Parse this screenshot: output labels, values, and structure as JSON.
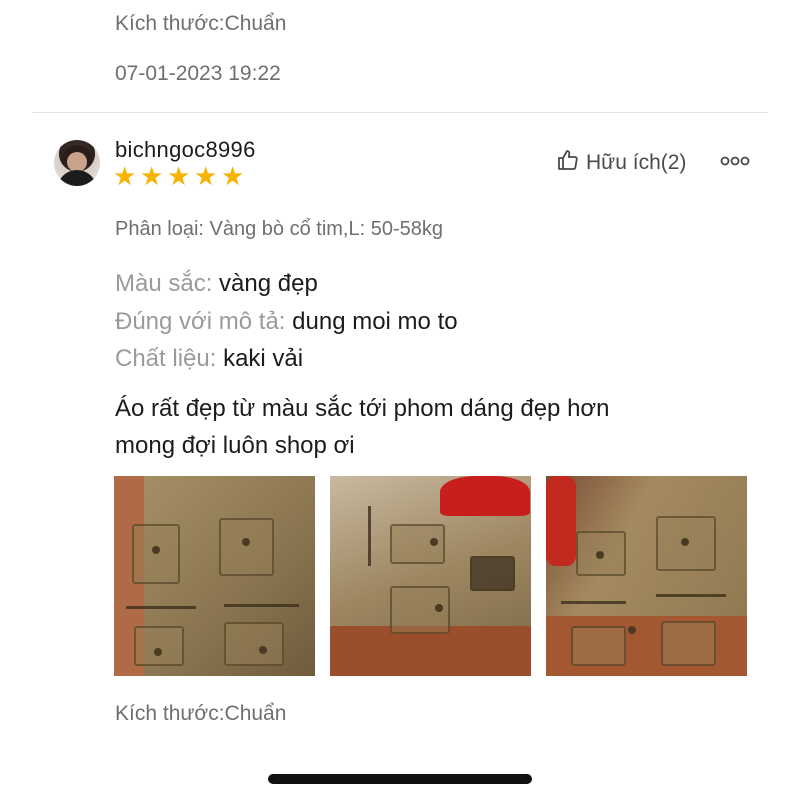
{
  "previous_review": {
    "size": "Kích thước:Chuẩn",
    "timestamp": "07-01-2023 19:22"
  },
  "review": {
    "username": "bichngoc8996",
    "rating": 5,
    "stars": [
      "★",
      "★",
      "★",
      "★",
      "★"
    ],
    "helpful_label": "Hữu ích(2)",
    "more_label": "ooo",
    "variant": "Phân loại: Vàng bò cổ tim,L: 50-58kg",
    "attributes": [
      {
        "key": "Màu sắc:",
        "value": "vàng đẹp"
      },
      {
        "key": "Đúng với mô tả:",
        "value": "dung moi mo to"
      },
      {
        "key": "Chất liệu:",
        "value": "kaki vải"
      }
    ],
    "comment_line1": "Áo rất đẹp từ màu sắc tới phom dáng đẹp hơn",
    "comment_line2": "mong đợi luôn shop ơi",
    "photos": [
      "vest-photo-front",
      "vest-photo-side",
      "vest-photo-hanging"
    ],
    "size": "Kích thước:Chuẩn"
  },
  "colors": {
    "star": "#f5b400",
    "muted_text": "#6f6f6f",
    "attr_key": "#9a9a9a",
    "text": "#1c1c1c"
  }
}
